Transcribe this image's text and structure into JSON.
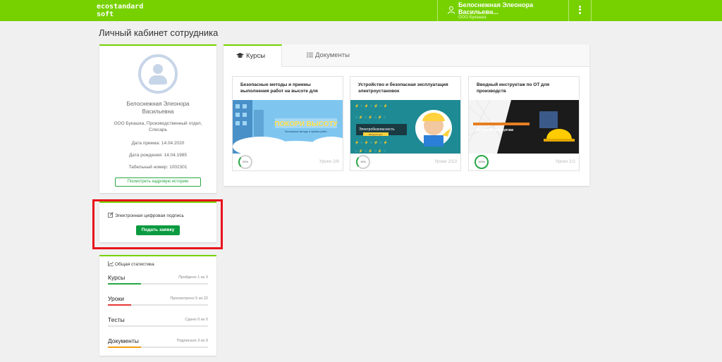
{
  "header": {
    "logo_line1": "ecostandard",
    "logo_line2": "soft",
    "user_name": "Белоснежная Элеонора Васильевн...",
    "user_org": "ООО Букашка",
    "bg_color": "#77d100"
  },
  "page_title": "Личный кабинет сотрудника",
  "profile": {
    "name": "Белоснежная Элеонора Васильевна",
    "org_position": "ООО Букашка, Производственный отдел, Слесарь",
    "hire_date": "Дата приема: 14.04.2020",
    "birth_date": "Дата рождения: 14.04.1985",
    "employee_number": "Табельный номер: 1002301",
    "history_button": "Посмотреть кадровую историю"
  },
  "eds": {
    "icon": "edit-icon",
    "title": "Электронная цифровая подпись",
    "button": "Подать заявку"
  },
  "stats": {
    "icon": "chart-icon",
    "title": "Общая статистика",
    "items": [
      {
        "label": "Курсы",
        "note": "Пройдено 1 из 3",
        "fraction": 0.33,
        "color": "#28a745"
      },
      {
        "label": "Уроки",
        "note": "Просмотрено 5 из 22",
        "fraction": 0.23,
        "color": "#e53935"
      },
      {
        "label": "Тесты",
        "note": "Сдано 0 из 0",
        "fraction": 0,
        "color": "#28a745"
      },
      {
        "label": "Документы",
        "note": "Подписано 3 из 9",
        "fraction": 0.33,
        "color": "#f39c12"
      }
    ]
  },
  "tabs": [
    {
      "label": "Курсы",
      "icon": "graduation-cap-icon",
      "active": true
    },
    {
      "label": "Документы",
      "icon": "list-icon",
      "active": false
    }
  ],
  "courses": [
    {
      "title": "Безопасные методы и приемы выполнения работ на высоте для",
      "banner": "ПОКОРИ ВЫСОТУ",
      "banner_sub": "Безопасные методы и приемы работ",
      "progress": "20%",
      "lessons": "Уроки 2/6"
    },
    {
      "title": "Устройство и безопасная эксплуатация электроустановок",
      "banner": "Электробезопасность",
      "banner_sub": "Вводный курс",
      "progress": "15%",
      "lessons": "Уроки 2/13"
    },
    {
      "title": "Вводный инструктаж по ОТ для производств",
      "banner": "Вводный инструктаж",
      "banner_sub": "",
      "progress": "100%",
      "lessons": "Уроки 1/1"
    }
  ]
}
